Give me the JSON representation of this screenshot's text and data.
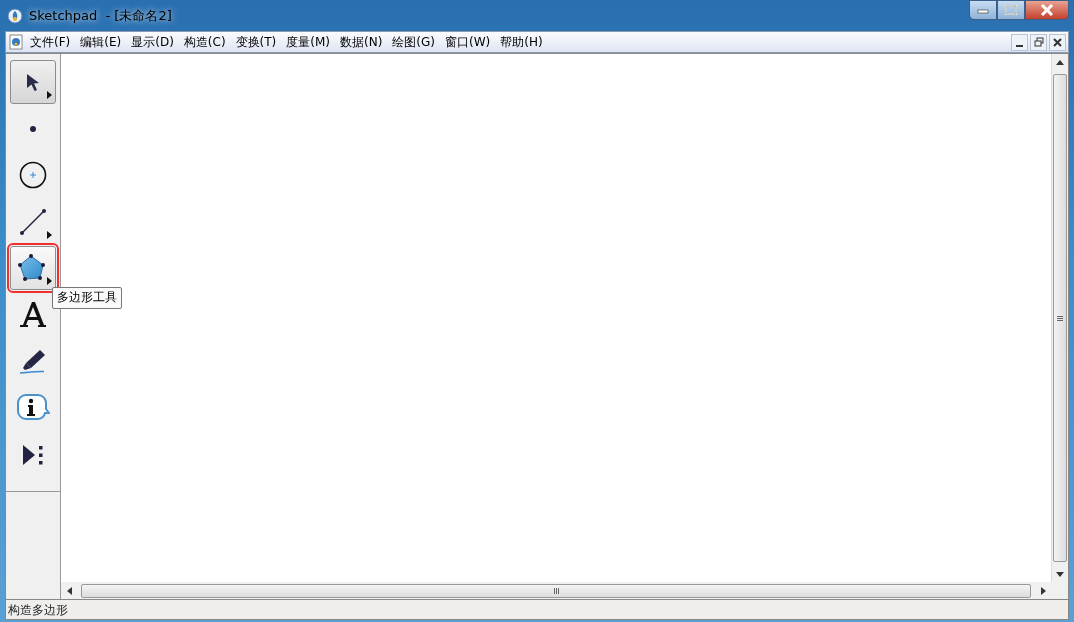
{
  "window": {
    "title": "Sketchpad  - [未命名2]"
  },
  "menu": [
    {
      "label": "文件(F)"
    },
    {
      "label": "编辑(E)"
    },
    {
      "label": "显示(D)"
    },
    {
      "label": "构造(C)"
    },
    {
      "label": "变换(T)"
    },
    {
      "label": "度量(M)"
    },
    {
      "label": "数据(N)"
    },
    {
      "label": "绘图(G)"
    },
    {
      "label": "窗口(W)"
    },
    {
      "label": "帮助(H)"
    }
  ],
  "tools": [
    {
      "kind": "arrow",
      "selected": true,
      "hovered": false,
      "submenu": true,
      "marked": false
    },
    {
      "kind": "point",
      "selected": false,
      "hovered": false,
      "submenu": false,
      "marked": false
    },
    {
      "kind": "compass",
      "selected": false,
      "hovered": false,
      "submenu": false,
      "marked": false
    },
    {
      "kind": "line",
      "selected": false,
      "hovered": false,
      "submenu": true,
      "marked": false
    },
    {
      "kind": "polygon",
      "selected": false,
      "hovered": true,
      "submenu": true,
      "marked": true,
      "tooltip": "多边形工具"
    },
    {
      "kind": "text",
      "selected": false,
      "hovered": false,
      "submenu": false,
      "marked": false
    },
    {
      "kind": "marker",
      "selected": false,
      "hovered": false,
      "submenu": false,
      "marked": false
    },
    {
      "kind": "info",
      "selected": false,
      "hovered": false,
      "submenu": false,
      "marked": false
    },
    {
      "kind": "custom",
      "selected": false,
      "hovered": false,
      "submenu": false,
      "marked": false
    }
  ],
  "status_bar": {
    "text": "构造多边形"
  }
}
